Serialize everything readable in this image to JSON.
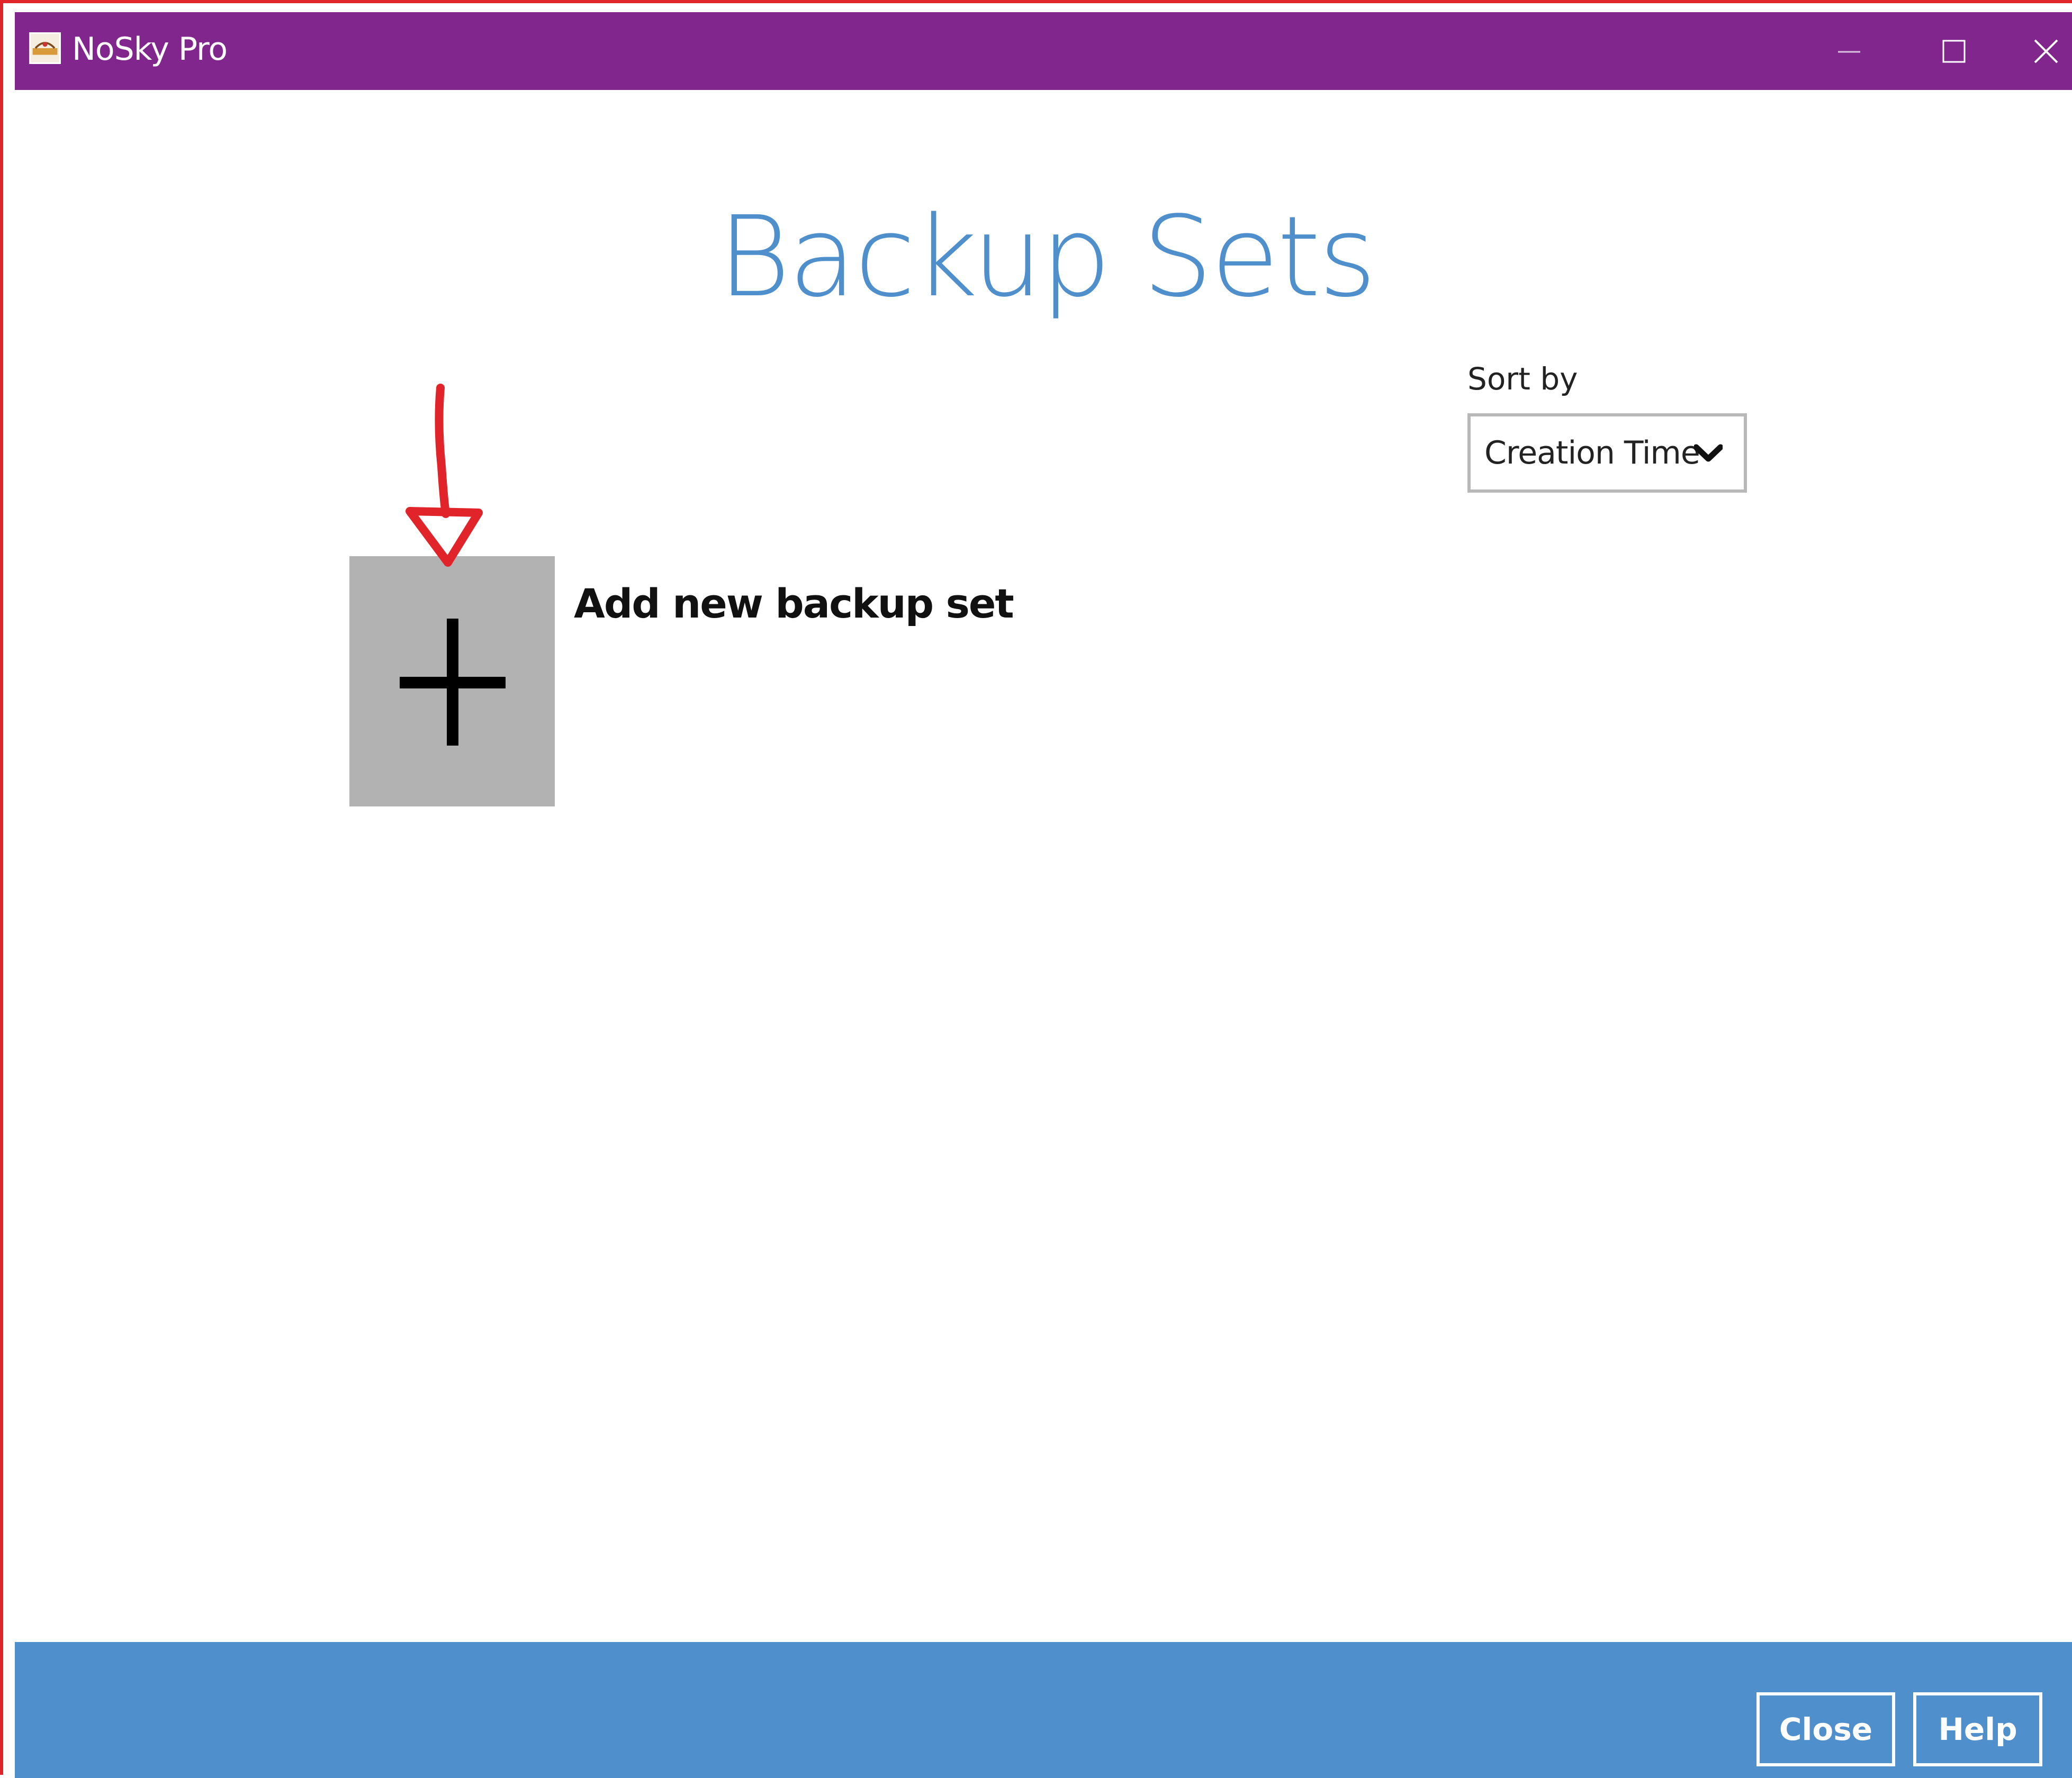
{
  "window": {
    "title": "NoSky Pro",
    "icon": "nosky-app-icon",
    "controls": {
      "minimize_icon": "minimize-icon",
      "maximize_icon": "maximize-icon",
      "close_icon": "close-icon"
    }
  },
  "main": {
    "title": "Backup Sets",
    "sort": {
      "label": "Sort by",
      "selected": "Creation Time",
      "icon": "chevron-down-icon"
    },
    "add_backup": {
      "label": "Add new backup set",
      "icon": "plus-icon"
    },
    "annotation": {
      "icon": "arrow-down-icon",
      "color": "#e0242a"
    }
  },
  "footer": {
    "close_label": "Close",
    "help_label": "Help"
  },
  "colors": {
    "titlebar": "#81268d",
    "accent": "#4f8fcc",
    "tile": "#b2b2b2",
    "annotation": "#e0242a"
  }
}
